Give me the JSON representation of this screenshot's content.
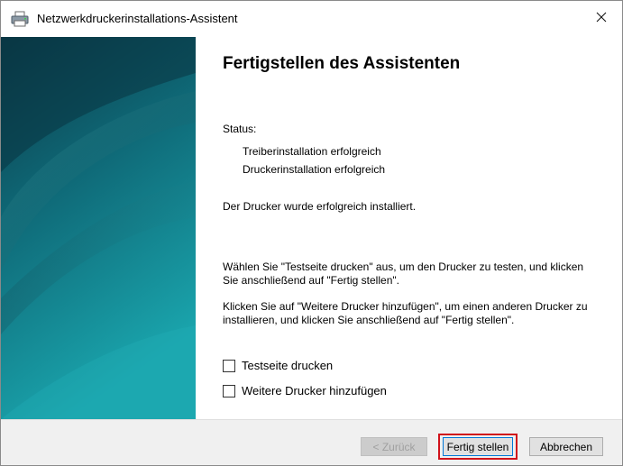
{
  "window": {
    "title": "Netzwerkdruckerinstallations-Assistent",
    "icon": "printer-icon",
    "close_glyph": "✕"
  },
  "content": {
    "heading": "Fertigstellen des Assistenten",
    "status_label": "Status:",
    "status_lines": [
      "Treiberinstallation erfolgreich",
      "Druckerinstallation erfolgreich"
    ],
    "installed_message": "Der Drucker wurde erfolgreich installiert.",
    "instruction_testpage": "Wählen Sie \"Testseite drucken\" aus, um den Drucker zu testen, und klicken Sie anschließend auf \"Fertig stellen\".",
    "instruction_more": "Klicken Sie auf \"Weitere Drucker hinzufügen\", um einen anderen Drucker zu installieren, und klicken Sie anschließend auf \"Fertig stellen\".",
    "checkboxes": [
      {
        "label": "Testseite drucken",
        "checked": false
      },
      {
        "label": "Weitere Drucker hinzufügen",
        "checked": false
      }
    ]
  },
  "footer": {
    "back_label": "< Zurück",
    "back_enabled": false,
    "finish_label": "Fertig stellen",
    "cancel_label": "Abbrechen"
  },
  "colors": {
    "side_panel_dark": "#0b3f4d",
    "side_panel_light": "#1aa0aa",
    "highlight_border": "#d0121b",
    "default_button_border": "#0078d7"
  }
}
